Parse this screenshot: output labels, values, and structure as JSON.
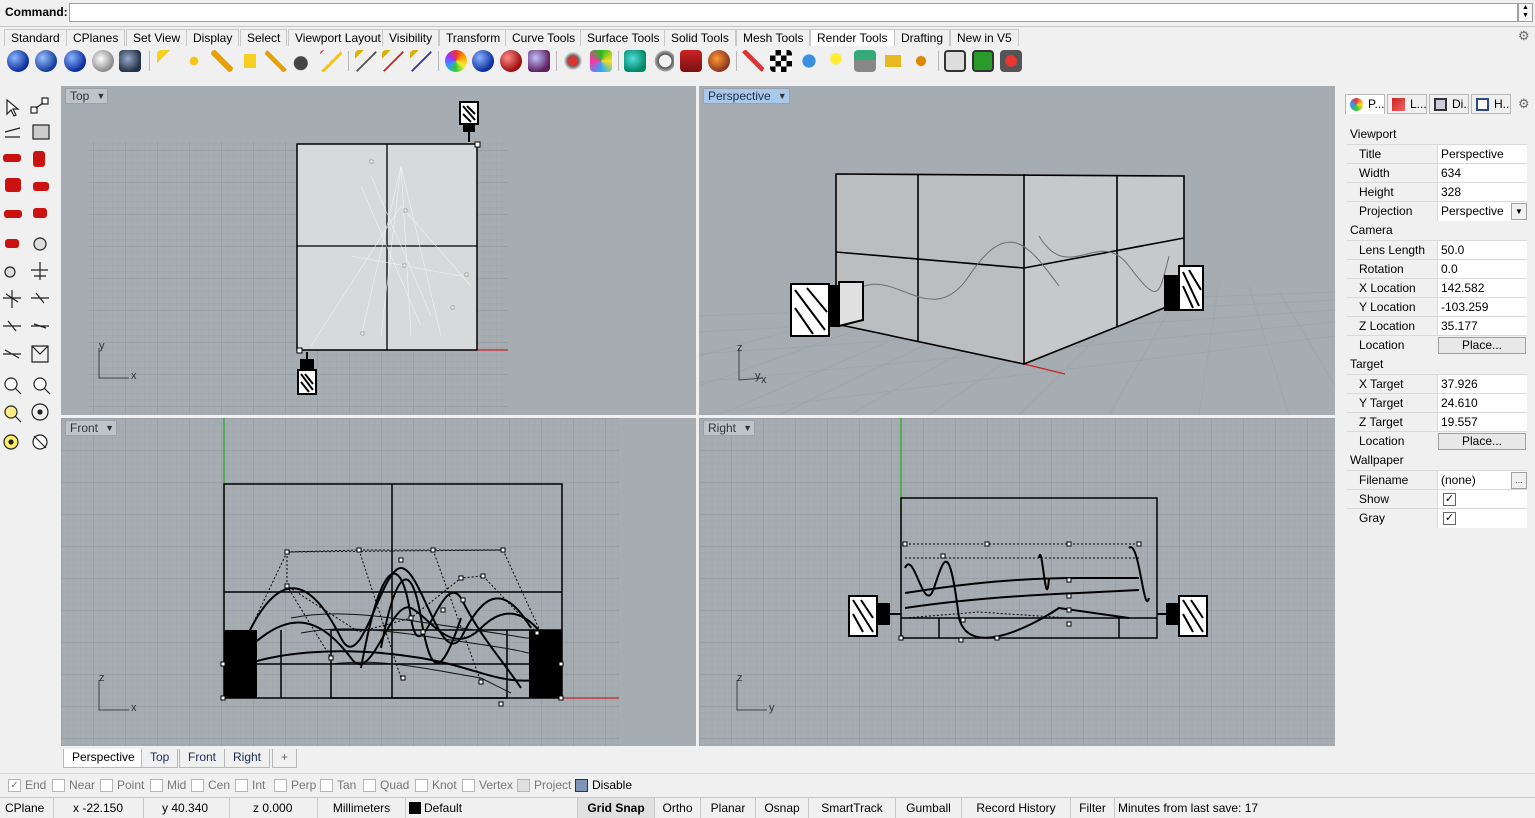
{
  "command": {
    "label": "Command:",
    "value": ""
  },
  "tabs": [
    "Standard",
    "CPlanes",
    "Set View",
    "Display",
    "Select",
    "Viewport Layout",
    "Visibility",
    "Transform",
    "Curve Tools",
    "Surface Tools",
    "Solid Tools",
    "Mesh Tools",
    "Render Tools",
    "Drafting",
    "New in V5"
  ],
  "active_tab": "Render Tools",
  "viewports": {
    "top": {
      "label": "Top",
      "axis_a": "y",
      "axis_b": "x"
    },
    "perspective": {
      "label": "Perspective",
      "axis_a": "z",
      "axis_b": "y",
      "axis_c": "x"
    },
    "front": {
      "label": "Front",
      "axis_a": "z",
      "axis_b": "x"
    },
    "right": {
      "label": "Right",
      "axis_a": "z",
      "axis_b": "y"
    }
  },
  "viewport_tabs": [
    "Perspective",
    "Top",
    "Front",
    "Right"
  ],
  "active_viewport_tab": "Perspective",
  "panel": {
    "tabs": [
      "P...",
      "L...",
      "Di...",
      "H..."
    ],
    "viewport_section": "Viewport",
    "title_label": "Title",
    "title_value": "Perspective",
    "width_label": "Width",
    "width_value": "634",
    "height_label": "Height",
    "height_value": "328",
    "projection_label": "Projection",
    "projection_value": "Perspective",
    "camera_section": "Camera",
    "lens_label": "Lens Length",
    "lens_value": "50.0",
    "rotation_label": "Rotation",
    "rotation_value": "0.0",
    "xloc_label": "X Location",
    "xloc_value": "142.582",
    "yloc_label": "Y Location",
    "yloc_value": "-103.259",
    "zloc_label": "Z Location",
    "zloc_value": "35.177",
    "cam_location_label": "Location",
    "cam_place_button": "Place...",
    "target_section": "Target",
    "xt_label": "X Target",
    "xt_value": "37.926",
    "yt_label": "Y Target",
    "yt_value": "24.610",
    "zt_label": "Z Target",
    "zt_value": "19.557",
    "tgt_location_label": "Location",
    "tgt_place_button": "Place...",
    "wallpaper_section": "Wallpaper",
    "filename_label": "Filename",
    "filename_value": "(none)",
    "filename_browse": "...",
    "show_label": "Show",
    "show_checked": true,
    "gray_label": "Gray",
    "gray_checked": true
  },
  "osnaps": [
    {
      "label": "End",
      "checked": true
    },
    {
      "label": "Near",
      "checked": false
    },
    {
      "label": "Point",
      "checked": false
    },
    {
      "label": "Mid",
      "checked": false
    },
    {
      "label": "Cen",
      "checked": false
    },
    {
      "label": "Int",
      "checked": false
    },
    {
      "label": "Perp",
      "checked": false
    },
    {
      "label": "Tan",
      "checked": false
    },
    {
      "label": "Quad",
      "checked": false
    },
    {
      "label": "Knot",
      "checked": false
    },
    {
      "label": "Vertex",
      "checked": false
    },
    {
      "label": "Project",
      "checked": false
    },
    {
      "label": "Disable",
      "checked": false
    }
  ],
  "status": {
    "cplane": "CPlane",
    "x": "x -22.150",
    "y": "y 40.340",
    "z": "z 0.000",
    "units": "Millimeters",
    "layer": "Default",
    "grid_snap": "Grid Snap",
    "ortho": "Ortho",
    "planar": "Planar",
    "osnap": "Osnap",
    "smarttrack": "SmartTrack",
    "gumball": "Gumball",
    "record_history": "Record History",
    "filter": "Filter",
    "save_info": "Minutes from last save: 17"
  },
  "colors": {
    "viewport_bg": "#a5acb2",
    "active_label": "#a9c8ea",
    "x_axis": "#cc2222",
    "y_axis": "#22aa22"
  }
}
